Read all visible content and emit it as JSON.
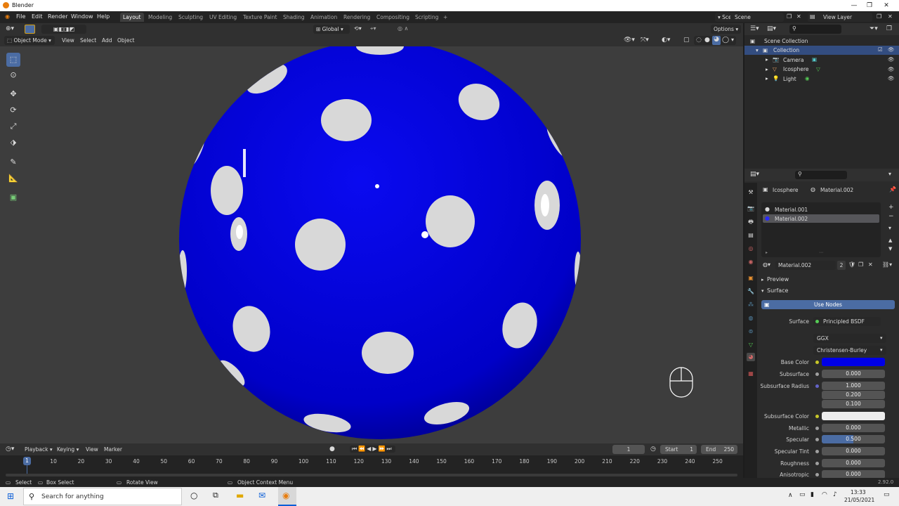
{
  "window": {
    "title": "Blender",
    "minimize": "—",
    "maximize": "❐",
    "close": "✕"
  },
  "menu": [
    "File",
    "Edit",
    "Render",
    "Window",
    "Help"
  ],
  "workspaces": [
    "Layout",
    "Modeling",
    "Sculpting",
    "UV Editing",
    "Texture Paint",
    "Shading",
    "Animation",
    "Rendering",
    "Compositing",
    "Scripting"
  ],
  "workspace_add": "+",
  "scene": {
    "name": "Scene",
    "view_layer": "View Layer"
  },
  "header": {
    "transform_orientation": "Global",
    "options": "Options",
    "mode": "Object Mode",
    "view": "View",
    "select": "Select",
    "add": "Add",
    "object": "Object"
  },
  "outliner": {
    "scene_collection": "Scene Collection",
    "collection": "Collection",
    "items": [
      "Camera",
      "Icosphere",
      "Light"
    ]
  },
  "properties": {
    "object": "Icosphere",
    "material": "Material.002",
    "slots": [
      "Material.001",
      "Material.002"
    ],
    "datablock": "Material.002",
    "users": "2",
    "preview": "Preview",
    "surface_panel": "Surface",
    "use_nodes": "Use Nodes",
    "surface_label": "Surface",
    "surface_value": "Principled BSDF",
    "distribution": "GGX",
    "subsurface_method": "Christensen-Burley",
    "base_color_label": "Base Color",
    "base_color": "#0000e6",
    "subsurface_label": "Subsurface",
    "subsurface": "0.000",
    "subsurface_radius_label": "Subsurface Radius",
    "subsurface_radius": [
      "1.000",
      "0.200",
      "0.100"
    ],
    "subsurface_color_label": "Subsurface Color",
    "metallic_label": "Metallic",
    "metallic": "0.000",
    "specular_label": "Specular",
    "specular": "0.500",
    "specular_fill": 0.5,
    "specular_tint_label": "Specular Tint",
    "specular_tint": "0.000",
    "roughness_label": "Roughness",
    "roughness": "0.000",
    "anisotropic_label": "Anisotropic",
    "anisotropic": "0.000"
  },
  "timeline": {
    "playback": "Playback",
    "keying": "Keying",
    "view": "View",
    "marker": "Marker",
    "current_frame": "1",
    "start_label": "Start",
    "start": "1",
    "end_label": "End",
    "end": "250",
    "ticks": [
      "10",
      "20",
      "30",
      "40",
      "50",
      "60",
      "70",
      "80",
      "90",
      "100",
      "110",
      "120",
      "130",
      "140",
      "150",
      "160",
      "170",
      "180",
      "190",
      "200",
      "210",
      "220",
      "230",
      "240",
      "250"
    ],
    "cursor": "1"
  },
  "status": {
    "select": "Select",
    "box_select": "Box Select",
    "rotate_view": "Rotate View",
    "context_menu": "Object Context Menu",
    "version": "2.92.0"
  },
  "taskbar": {
    "search": "Search for anything",
    "time": "13:33",
    "date": "21/05/2021"
  },
  "colors": {
    "sphere": "#0000d0",
    "spots": "#d8d8d8",
    "accent": "#4b6ca3"
  }
}
